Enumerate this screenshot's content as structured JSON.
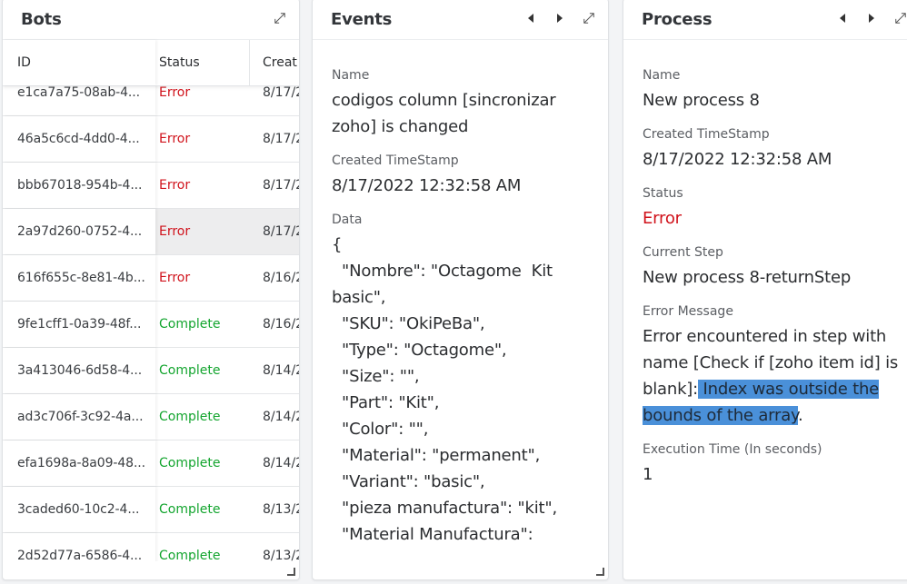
{
  "colors": {
    "error": "#d0121b",
    "complete": "#14a52f",
    "selection_highlight": "#4a90d9",
    "selected_row": "#ededee"
  },
  "bots": {
    "title": "Bots",
    "icons": {
      "expand": "expand-icon",
      "resize": "resize-handle-icon"
    },
    "columns": [
      "ID",
      "Status",
      "Created"
    ],
    "columns_visible_text": [
      "ID",
      "Status",
      "Creat"
    ],
    "rows": [
      {
        "id": "e1ca7a75-08ab-4...",
        "status": "Error",
        "created": "8/17/2"
      },
      {
        "id": "46a5c6cd-4dd0-4...",
        "status": "Error",
        "created": "8/17/2"
      },
      {
        "id": "bbb67018-954b-4...",
        "status": "Error",
        "created": "8/17/2"
      },
      {
        "id": "2a97d260-0752-4...",
        "status": "Error",
        "created": "8/17/2",
        "selected": true
      },
      {
        "id": "616f655c-8e81-4b...",
        "status": "Error",
        "created": "8/16/2"
      },
      {
        "id": "9fe1cff1-0a39-48f...",
        "status": "Complete",
        "created": "8/16/2"
      },
      {
        "id": "3a413046-6d58-4...",
        "status": "Complete",
        "created": "8/14/2"
      },
      {
        "id": "ad3c706f-3c92-4a...",
        "status": "Complete",
        "created": "8/14/2"
      },
      {
        "id": "efa1698a-8a09-48...",
        "status": "Complete",
        "created": "8/14/2"
      },
      {
        "id": "3caded60-10c2-4...",
        "status": "Complete",
        "created": "8/13/2"
      },
      {
        "id": "2d52d77a-6586-4...",
        "status": "Complete",
        "created": "8/13/2"
      }
    ]
  },
  "events": {
    "title": "Events",
    "icons": {
      "prev": "caret-left-icon",
      "next": "caret-right-icon",
      "expand": "expand-icon",
      "resize": "resize-handle-icon"
    },
    "name_label": "Name",
    "name_value": "codigos column [sincronizar zoho] is changed",
    "created_label": "Created TimeStamp",
    "created_value": "8/17/2022 12:32:58 AM",
    "data_label": "Data",
    "data_lines": [
      "{",
      "  \"Nombre\": \"Octagome  Kit basic\",",
      "  \"SKU\": \"OkiPeBa\",",
      "  \"Type\": \"Octagome\",",
      "  \"Size\": \"\",",
      "  \"Part\": \"Kit\",",
      "  \"Color\": \"\",",
      "  \"Material\": \"permanent\",",
      "  \"Variant\": \"basic\",",
      "  \"pieza manufactura\": \"kit\",",
      "  \"Material Manufactura\":"
    ]
  },
  "process": {
    "title": "Process",
    "icons": {
      "prev": "caret-left-icon",
      "next": "caret-right-icon",
      "expand": "expand-icon"
    },
    "name_label": "Name",
    "name_value": "New process 8",
    "created_label": "Created TimeStamp",
    "created_value": "8/17/2022 12:32:58 AM",
    "status_label": "Status",
    "status_value": "Error",
    "step_label": "Current Step",
    "step_value": "New process 8-returnStep",
    "error_label": "Error Message",
    "error_prefix": "Error encountered in step with name [Check if [zoho item id] is blank]:",
    "error_selected": " Index was outside the bounds of the array",
    "error_suffix": ".",
    "exec_label": "Execution Time (In seconds)",
    "exec_value": "1"
  }
}
